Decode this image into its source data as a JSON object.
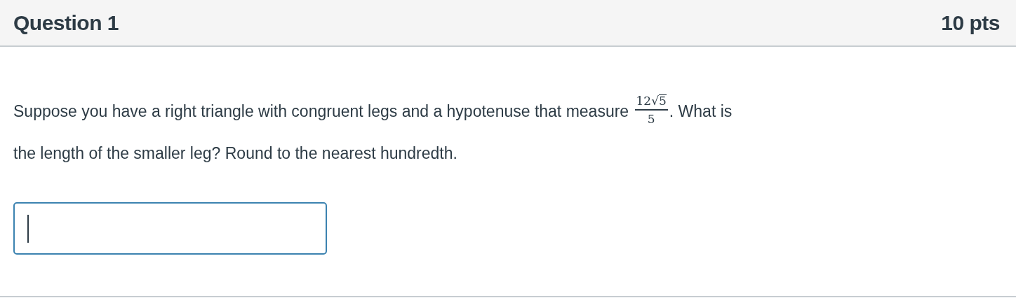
{
  "question": {
    "title": "Question 1",
    "points": "10 pts"
  },
  "prompt": {
    "text_before": "Suppose you have a right triangle with congruent legs and a hypotenuse that measure",
    "fraction": {
      "coefficient": "12",
      "radical_sign": "√",
      "radicand": "5",
      "denominator": "5"
    },
    "text_after": ". What is",
    "second_line": "the length of the smaller leg? Round to the nearest hundredth."
  },
  "answer": {
    "focused": true
  }
}
